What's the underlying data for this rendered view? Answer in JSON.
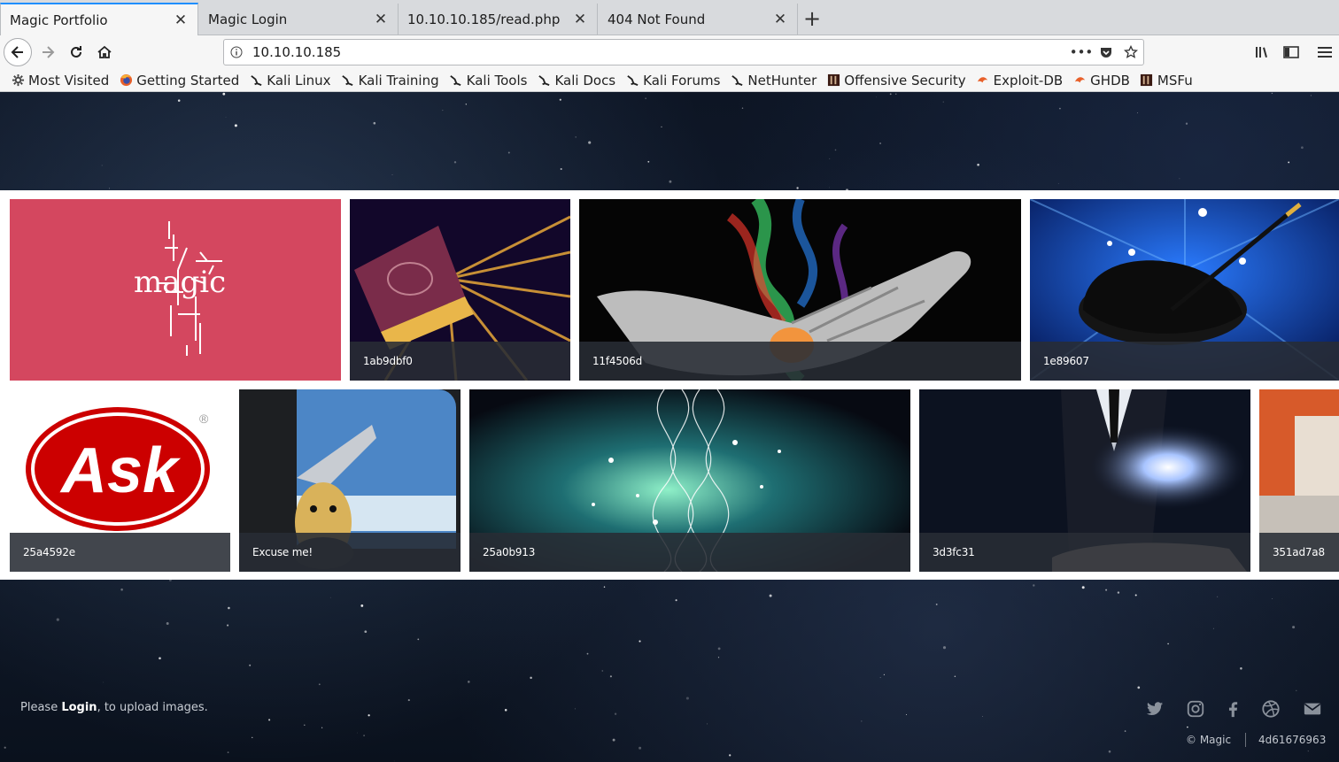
{
  "tabs": [
    {
      "title": "Magic Portfolio",
      "active": true
    },
    {
      "title": "Magic Login",
      "active": false
    },
    {
      "title": "10.10.10.185/read.php",
      "active": false
    },
    {
      "title": "404 Not Found",
      "active": false
    }
  ],
  "new_tab_icon": "plus-icon",
  "address": {
    "url": "10.10.10.185"
  },
  "bookmarks": [
    {
      "label": "Most Visited",
      "icon": "gear-icon"
    },
    {
      "label": "Getting Started",
      "icon": "firefox-icon"
    },
    {
      "label": "Kali Linux",
      "icon": "kali-dragon-icon"
    },
    {
      "label": "Kali Training",
      "icon": "kali-dragon-icon"
    },
    {
      "label": "Kali Tools",
      "icon": "kali-dragon-icon"
    },
    {
      "label": "Kali Docs",
      "icon": "kali-dragon-icon"
    },
    {
      "label": "Kali Forums",
      "icon": "kali-dragon-icon"
    },
    {
      "label": "NetHunter",
      "icon": "kali-dragon-icon"
    },
    {
      "label": "Offensive Security",
      "icon": "offsec-icon"
    },
    {
      "label": "Exploit-DB",
      "icon": "exploitdb-icon"
    },
    {
      "label": "GHDB",
      "icon": "exploitdb-icon"
    },
    {
      "label": "MSFu",
      "icon": "offsec-icon"
    }
  ],
  "gallery": {
    "items": [
      {
        "caption": "",
        "art": "magic-text"
      },
      {
        "caption": "1ab9dbf0",
        "art": "glowing-book"
      },
      {
        "caption": "11f4506d",
        "art": "smoke-hand"
      },
      {
        "caption": "1e89607",
        "art": "top-hat-wand"
      },
      {
        "caption": "25a4592e",
        "art": "ask-logo"
      },
      {
        "caption": "Excuse me!",
        "art": "duck-window"
      },
      {
        "caption": "25a0b913",
        "art": "sparkle-streams"
      },
      {
        "caption": "3d3fc31",
        "art": "galaxy-hand"
      },
      {
        "caption": "351ad7a8",
        "art": "orange-partial"
      }
    ],
    "ask_logo_text": "Ask",
    "ask_logo_mark": "®",
    "magic_art_text": "magic"
  },
  "footer": {
    "upload_prefix": "Please ",
    "login_link": "Login",
    "upload_suffix": ", to upload images.",
    "social": [
      "twitter-icon",
      "instagram-icon",
      "facebook-icon",
      "dribbble-icon",
      "mail-icon"
    ],
    "copyright": "© Magic",
    "hex_id": "4d61676963"
  }
}
